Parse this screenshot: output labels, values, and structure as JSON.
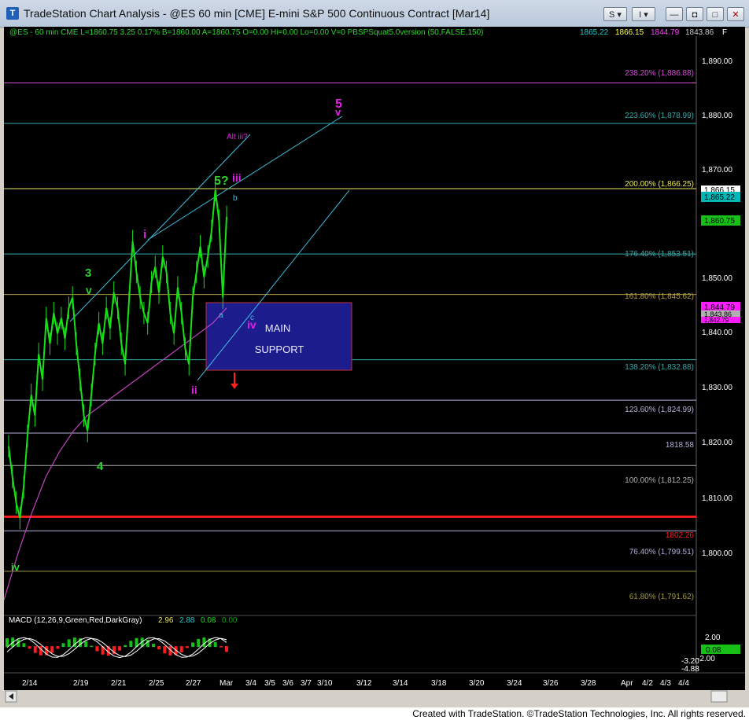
{
  "window": {
    "title": "TradeStation Chart Analysis - @ES 60 min [CME] E-mini S&P 500 Continuous Contract [Mar14]",
    "btn_s": "S",
    "btn_i": "I",
    "btn_min": "—",
    "btn_max": "□",
    "btn_restore": "◘",
    "btn_close": "✕"
  },
  "header_line": {
    "text1": "@ES - 60 min  CME  L=1860.75  3.25  0.17%  B=1860.00  A=1860.75  O=0.00  Hi=0.00  Lo=0.00  V=0  PBSPSquat5.0version (50,FALSE,150)",
    "v1": "1865.22",
    "v2": "1866.15",
    "v3": "1844.79",
    "v4": "1843.86",
    "v5": "F"
  },
  "footer": "Created with TradeStation. ©TradeStation Technologies, Inc. All rights reserved.",
  "colors": {
    "bars": "#16e016",
    "ma": "#c044c0",
    "fib_line": "#a8a8c8",
    "wave_green": "#2fd32f",
    "wave_magenta": "#e020e0",
    "channel": "#40c0e0",
    "support_box": "#1c1c8c",
    "red_line": "#ff1010"
  },
  "chart_data": {
    "type": "line",
    "symbol": "@ES",
    "interval": "60 min",
    "y_range": [
      1783,
      1896
    ],
    "y_ticks": [
      "1,890.00",
      "1,880.00",
      "1,870.00",
      "1,850.00",
      "1,840.00",
      "1,830.00",
      "1,820.00",
      "1,810.00",
      "1,800.00"
    ],
    "x_ticks": [
      "2/14",
      "2/19",
      "2/21",
      "2/25",
      "2/27",
      "Mar",
      "3/4",
      "3/5",
      "3/6",
      "3/7",
      "3/10",
      "3/12",
      "3/14",
      "3/18",
      "3/20",
      "3/24",
      "3/26",
      "3/28",
      "Apr",
      "4/2",
      "4/3",
      "4/4"
    ],
    "price_path": [
      1816,
      1810,
      1805,
      1802,
      1808,
      1818,
      1826,
      1822,
      1834,
      1829,
      1841,
      1836,
      1842,
      1838,
      1841,
      1837,
      1843,
      1845,
      1836,
      1829,
      1822,
      1819,
      1826,
      1834,
      1840,
      1836,
      1843,
      1839,
      1846,
      1843,
      1836,
      1832,
      1844,
      1856,
      1850,
      1845,
      1842,
      1840,
      1848,
      1851,
      1846,
      1853,
      1850,
      1842,
      1838,
      1847,
      1842,
      1835,
      1832,
      1845,
      1850,
      1855,
      1849,
      1853,
      1858,
      1866,
      1860,
      1845,
      1860.75
    ],
    "ma_path": [
      1786,
      1795,
      1803,
      1810,
      1815,
      1819,
      1822,
      1824,
      1826,
      1828,
      1830,
      1832,
      1834,
      1836,
      1838,
      1840,
      1843
    ],
    "fib_levels": [
      {
        "label": "238.20% (1,886.88)",
        "value": 1886.88,
        "color": "#d04cd0"
      },
      {
        "label": "223.60% (1,878.99)",
        "value": 1878.99,
        "color": "#39a7a7"
      },
      {
        "label": "200.00% (1,866.25)",
        "value": 1866.25,
        "color": "#e8e85a"
      },
      {
        "label": "176.40% (1,853.51)",
        "value": 1853.51,
        "color": "#39a7a7"
      },
      {
        "label": "161.80% (1,845.62)",
        "value": 1845.62,
        "color": "#b09a44"
      },
      {
        "label": "138.20% (1,832.88)",
        "value": 1832.88,
        "color": "#39a7a7"
      },
      {
        "label": "123.60% (1,824.99)",
        "value": 1824.99,
        "color": "#b0b0d8"
      },
      {
        "label": "1818.58",
        "value": 1818.58,
        "color": "#b0b0d8"
      },
      {
        "label": "100.00% (1,812.25)",
        "value": 1812.25,
        "color": "#b0b0b0"
      },
      {
        "label": "1802.26",
        "value": 1802.26,
        "color": "#ff1c1c"
      },
      {
        "label": "76.40% (1,799.51)",
        "value": 1799.51,
        "color": "#b0b0d8"
      },
      {
        "label": "61.80% (1,791.62)",
        "value": 1791.62,
        "color": "#a09a44"
      }
    ],
    "right_badges": [
      {
        "label": "1,866.15",
        "value": 1866.15,
        "bg": "#ffffff",
        "fg": "#000000"
      },
      {
        "label": "1,865.22",
        "value": 1865.22,
        "bg": "#00b8b8",
        "fg": "#000000"
      },
      {
        "label": "1,860.75",
        "value": 1860.75,
        "bg": "#16c016",
        "fg": "#000000"
      },
      {
        "label": "1,844.79",
        "value": 1844.79,
        "bg": "#ff1cff",
        "fg": "#000000"
      },
      {
        "label": "1,843.86",
        "value": 1843.86,
        "bg": "#b0b0b0",
        "fg": "#000000"
      },
      {
        "label": "1,842.79",
        "value": 1842.79,
        "bg": "#ff1cff",
        "fg": "#000000"
      }
    ],
    "wave_labels": [
      {
        "text": "5",
        "color": "#e020e0"
      },
      {
        "text": "v",
        "color": "#e020e0"
      },
      {
        "text": "Alt iii?",
        "color": "#e020e0"
      },
      {
        "text": "5?",
        "color": "#2fd32f"
      },
      {
        "text": "iii",
        "color": "#e020e0"
      },
      {
        "text": "b",
        "color": "#40c0e0"
      },
      {
        "text": "i",
        "color": "#e020e0"
      },
      {
        "text": "3",
        "color": "#2fd32f"
      },
      {
        "text": "v",
        "color": "#2fd32f"
      },
      {
        "text": "a",
        "color": "#40c0e0"
      },
      {
        "text": "c",
        "color": "#40c0e0"
      },
      {
        "text": "iv",
        "color": "#e020e0"
      },
      {
        "text": "ii",
        "color": "#e020e0"
      },
      {
        "text": "4",
        "color": "#2fd32f"
      },
      {
        "text": "iv",
        "color": "#2fd32f"
      }
    ],
    "support_box_text": [
      "MAIN",
      "SUPPORT"
    ],
    "macd": {
      "label": "MACD (12,26,9,Green,Red,DarkGray)",
      "v1": "2.96",
      "v2": "2.88",
      "v3": "0.08",
      "v4": "0.00",
      "ticks": [
        "2.00",
        "-2.00"
      ],
      "right_values": [
        "0.08",
        "-3.20",
        "-4.88"
      ],
      "y_range": [
        -5.5,
        4.5
      ]
    }
  }
}
